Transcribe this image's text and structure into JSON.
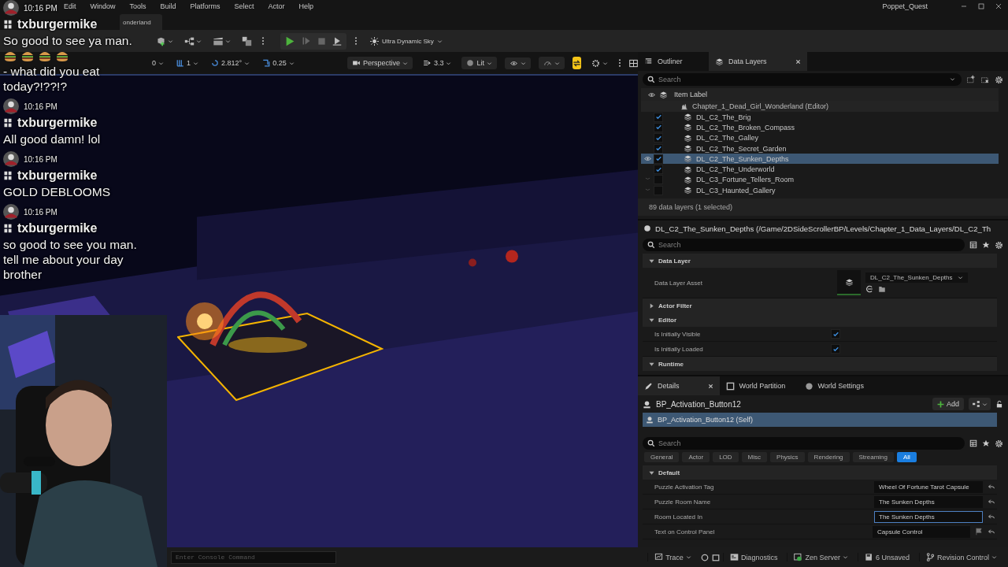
{
  "menu": [
    "Edit",
    "Window",
    "Tools",
    "Build",
    "Platforms",
    "Select",
    "Actor",
    "Help"
  ],
  "project_title": "Poppet_Quest",
  "level_tab": "onderland",
  "toolbar": {
    "sky_label": "Ultra Dynamic Sky"
  },
  "viewport_toolbar": {
    "snap": "0",
    "grid": "1",
    "rotation": "2.812°",
    "scale": "0.25",
    "view": "Perspective",
    "camera_speed": "3.3",
    "view_mode": "Lit",
    "toggle_on": true
  },
  "chat": [
    {
      "time": "10:16 PM",
      "user": "txburgermike",
      "text": "So good to see ya man.",
      "emotes": [
        {
          "kind": "burger"
        },
        {
          "kind": "burger"
        },
        {
          "kind": "burger"
        },
        {
          "kind": "burger"
        }
      ],
      "text_after": "- what did you eat today?!??!?"
    },
    {
      "time": "10:16 PM",
      "user": "txburgermike",
      "text": "All good damn! lol"
    },
    {
      "time": "10:16 PM",
      "user": "txburgermike",
      "text": "GOLD DEBLOOMS"
    },
    {
      "time": "10:16 PM",
      "user": "txburgermike",
      "text": "so good to see you man. tell me about your day brother"
    }
  ],
  "outliner": {
    "tabs": [
      {
        "label": "Outliner",
        "selected": false,
        "closable": false
      },
      {
        "label": "Data Layers",
        "selected": true,
        "closable": true
      }
    ],
    "search_placeholder": "Search",
    "column": "Item Label",
    "root": {
      "label": "Chapter_1_Dead_Girl_Wonderland (Editor)",
      "children": [
        {
          "label": "DL_C2_The_Brig",
          "checked": true,
          "hidden": false,
          "selected": false
        },
        {
          "label": "DL_C2_The_Broken_Compass",
          "checked": true,
          "hidden": false,
          "selected": false
        },
        {
          "label": "DL_C2_The_Galley",
          "checked": true,
          "hidden": false,
          "selected": false
        },
        {
          "label": "DL_C2_The_Secret_Garden",
          "checked": true,
          "hidden": false,
          "selected": false
        },
        {
          "label": "DL_C2_The_Sunken_Depths",
          "checked": true,
          "hidden": false,
          "selected": true
        },
        {
          "label": "DL_C2_The_Underworld",
          "checked": true,
          "hidden": false,
          "selected": false
        },
        {
          "label": "DL_C3_Fortune_Tellers_Room",
          "checked": false,
          "hidden": true,
          "selected": false
        },
        {
          "label": "DL_C3_Haunted_Gallery",
          "checked": false,
          "hidden": true,
          "selected": false
        }
      ]
    },
    "footer": "89 data layers (1 selected)"
  },
  "data_layer_details": {
    "title": "DL_C2_The_Sunken_Depths (/Game/2DSideScrollerBP/Levels/Chapter_1_Data_Layers/DL_C2_Th",
    "search_placeholder": "Search",
    "sections": [
      {
        "label": "Data Layer",
        "expanded": true,
        "properties": [
          {
            "kind": "asset",
            "label": "Data Layer Asset",
            "value": "DL_C2_The_Sunken_Depths"
          }
        ]
      },
      {
        "label": "Actor Filter",
        "expanded": false
      },
      {
        "label": "Editor",
        "expanded": true,
        "properties": [
          {
            "kind": "checkbox",
            "label": "Is Initially Visible",
            "checked": true
          },
          {
            "kind": "checkbox",
            "label": "Is Initially Loaded",
            "checked": true
          }
        ]
      },
      {
        "label": "Runtime",
        "expanded": true
      }
    ]
  },
  "details": {
    "tabs": [
      {
        "label": "Details",
        "selected": true,
        "closable": true
      },
      {
        "label": "World Partition",
        "selected": false,
        "closable": false
      },
      {
        "label": "World Settings",
        "selected": false,
        "closable": false
      }
    ],
    "actor": "BP_Activation_Button12",
    "add_label": "Add",
    "components": [
      {
        "label": "BP_Activation_Button12 (Self)",
        "selected": true
      }
    ],
    "search_placeholder": "Search",
    "filters": [
      {
        "label": "General",
        "selected": false
      },
      {
        "label": "Actor",
        "selected": false
      },
      {
        "label": "LOD",
        "selected": false
      },
      {
        "label": "Misc",
        "selected": false
      },
      {
        "label": "Physics",
        "selected": false
      },
      {
        "label": "Rendering",
        "selected": false
      },
      {
        "label": "Streaming",
        "selected": false
      },
      {
        "label": "All",
        "selected": true
      }
    ],
    "section": {
      "label": "Default",
      "expanded": true
    },
    "properties": [
      {
        "label": "Puzzle Activation Tag",
        "value": "Wheel Of Fortune Tarot Capsule",
        "focused": false,
        "flag": false
      },
      {
        "label": "Puzzle Room Name",
        "value": "The Sunken Depths",
        "focused": false,
        "flag": false
      },
      {
        "label": "Room Located In",
        "value": "The Sunken Depths",
        "focused": true,
        "flag": false
      },
      {
        "label": "Text on Control Panel",
        "value": "Capsule Control",
        "focused": false,
        "flag": true
      }
    ]
  },
  "status_bar": {
    "console_placeholder": "Enter Console Command",
    "items": [
      {
        "kind": "trace",
        "label": "Trace"
      },
      {
        "kind": "diagnostics",
        "label": "Diagnostics"
      },
      {
        "kind": "zen",
        "label": "Zen Server"
      },
      {
        "kind": "unsaved",
        "label": "6 Unsaved"
      },
      {
        "kind": "revision",
        "label": "Revision Control"
      }
    ]
  }
}
